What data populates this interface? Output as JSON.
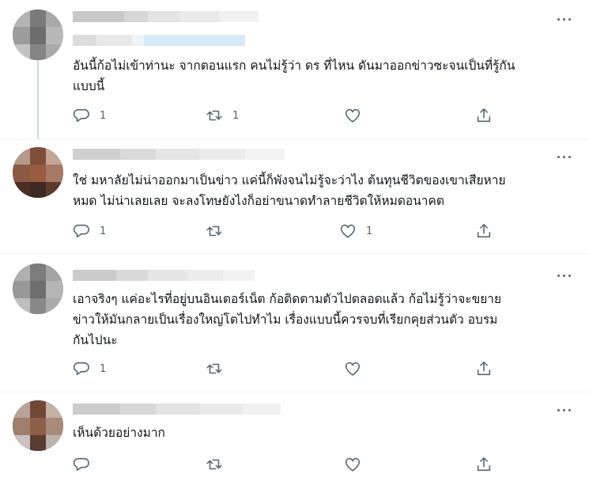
{
  "icons": {
    "more": "more-dots-icon",
    "reply": "reply-icon",
    "retweet": "retweet-icon",
    "like": "like-heart-icon",
    "share": "share-icon"
  },
  "colors": {
    "icon": "#536471",
    "text": "#0f1419",
    "divider": "#eff3f4",
    "thread_line": "#cfd9de"
  },
  "tweets": [
    {
      "text": "อันนี้ก้อไม่เข้าท่านะ จากตอนแรก คนไม่รู้ว่า ดร ที่ไหน ดันมาออกข่าวซะจนเป็นที่รู้กัน\nแบบนี้",
      "reply_count": "1",
      "retweet_count": "1",
      "like_count": ""
    },
    {
      "text": "ใช่ มหาลัยไม่น่าออกมาเป็นข่าว แค่นี้ก็พังจนไม่รู้จะว่าไง ต้นทุนชีวิตของเขาเสียหาย\nหมด ไม่น่าเลยเลย จะลงโทษยังไงก็อย่าขนาดทำลายชีวิตให้หมดอนาคต",
      "reply_count": "1",
      "retweet_count": "",
      "like_count": "1"
    },
    {
      "text": "เอาจริงๆ แค่อะไรที่อยู่บนอินเตอร์เน็ต ก้อติดตามตัวไปตลอดแล้ว ก้อไม่รู้ว่าจะขยาย\nข่าวให้มันกลายเป็นเรื่องใหญ่โตไปทำไม เรื่องแบบนี้ควรจบที่เรียกคุยส่วนตัว อบรม\nกันไปนะ",
      "reply_count": "1",
      "retweet_count": "",
      "like_count": ""
    },
    {
      "text": "เห็นด้วยอย่างมาก",
      "reply_count": "",
      "retweet_count": "",
      "like_count": ""
    }
  ]
}
